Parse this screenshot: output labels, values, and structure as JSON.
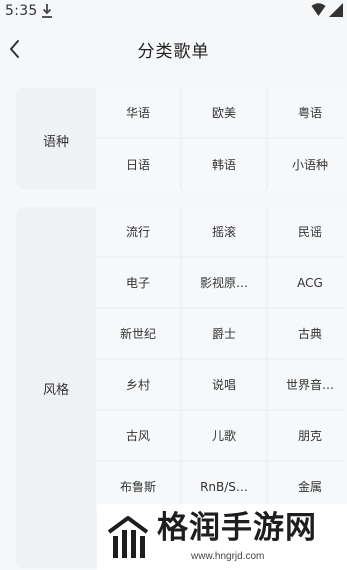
{
  "status_bar": {
    "time": "5:35"
  },
  "header": {
    "title": "分类歌单"
  },
  "sections": [
    {
      "label": "语种",
      "items": [
        "华语",
        "欧美",
        "粤语",
        "日语",
        "韩语",
        "小语种"
      ]
    },
    {
      "label": "风格",
      "items": [
        "流行",
        "摇滚",
        "民谣",
        "电子",
        "影视原…",
        "ACG",
        "新世纪",
        "爵士",
        "古典",
        "乡村",
        "说唱",
        "世界音…",
        "古风",
        "儿歌",
        "朋克",
        "布鲁斯",
        "RnB/S…",
        "金属"
      ]
    }
  ],
  "watermark": {
    "title": "格润手游网",
    "url": "www.hngrjd.com"
  }
}
